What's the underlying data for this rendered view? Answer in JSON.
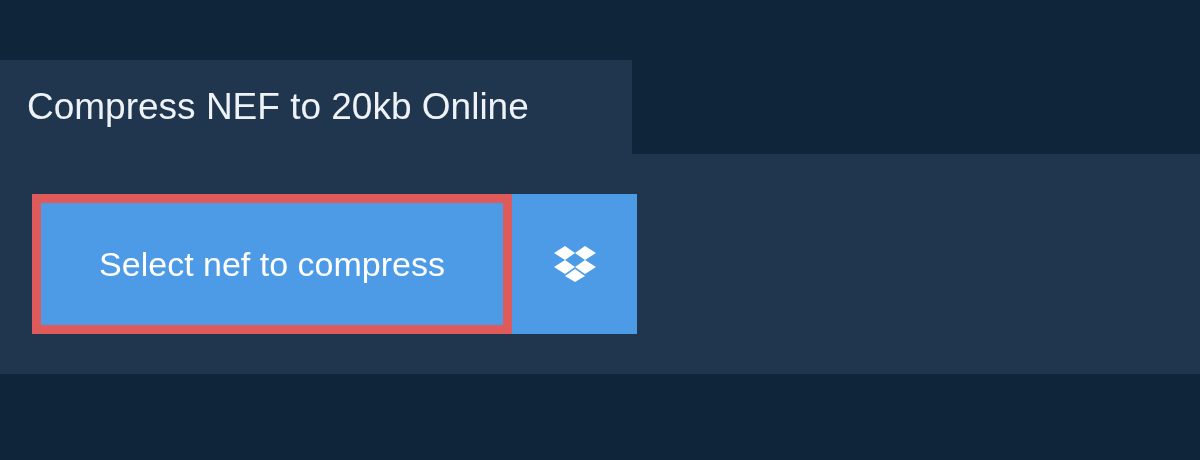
{
  "tab": {
    "title": "Compress NEF to 20kb Online"
  },
  "buttons": [
    {
      "kind": "select",
      "label": "Select nef to compress",
      "focused": true
    },
    {
      "kind": "dropbox",
      "focused": false
    }
  ]
}
